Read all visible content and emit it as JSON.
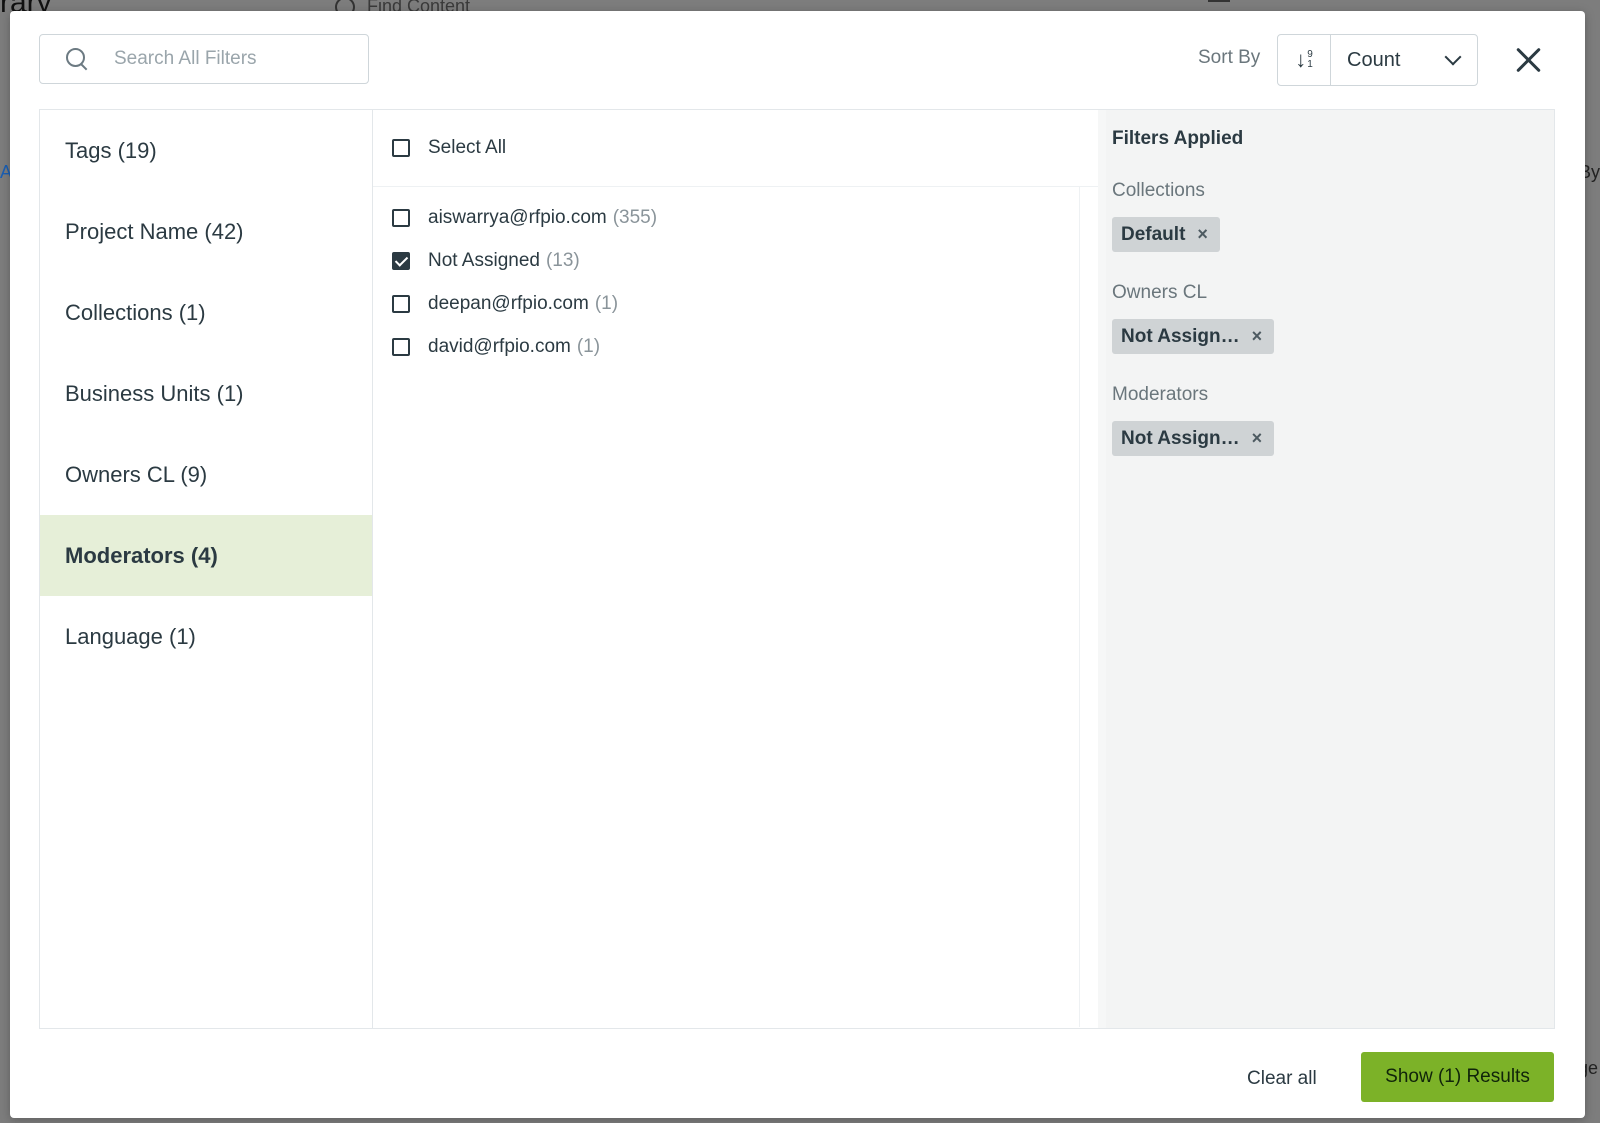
{
  "backdrop": {
    "title_fragment": "rary",
    "search_fragment": "Find Content",
    "left_edge_fragment": "A",
    "right_edge_fragment": "By",
    "right_edge_fragment2": "ge"
  },
  "search": {
    "placeholder": "Search All Filters",
    "value": ""
  },
  "sort": {
    "label": "Sort By",
    "direction_icon": "sort-numeric-icon",
    "direction_digits_top": "9",
    "direction_digits_bottom": "1",
    "selected": "Count"
  },
  "categories": [
    {
      "label": "Tags (19)"
    },
    {
      "label": "Project Name (42)"
    },
    {
      "label": "Collections (1)"
    },
    {
      "label": "Business Units (1)"
    },
    {
      "label": "Owners CL (9)"
    },
    {
      "label": "Moderators (4)",
      "active": true
    },
    {
      "label": "Language (1)"
    }
  ],
  "options": {
    "select_all_label": "Select All",
    "items": [
      {
        "label": "aiswarrya@rfpio.com",
        "count": "(355)",
        "checked": false
      },
      {
        "label": "Not Assigned",
        "count": "(13)",
        "checked": true
      },
      {
        "label": "deepan@rfpio.com",
        "count": "(1)",
        "checked": false
      },
      {
        "label": "david@rfpio.com",
        "count": "(1)",
        "checked": false
      }
    ]
  },
  "applied": {
    "title": "Filters Applied",
    "groups": [
      {
        "label": "Collections",
        "chip": "Default"
      },
      {
        "label": "Owners CL",
        "chip": "Not Assign…"
      },
      {
        "label": "Moderators",
        "chip": "Not Assign…"
      }
    ],
    "remove_glyph": "×"
  },
  "footer": {
    "clear_label": "Clear all",
    "show_label": "Show (1) Results"
  },
  "colors": {
    "accent_green": "#7cb228",
    "active_row": "#e6efd8",
    "chip_bg": "#cfd3d5",
    "text": "#2b3a42"
  }
}
